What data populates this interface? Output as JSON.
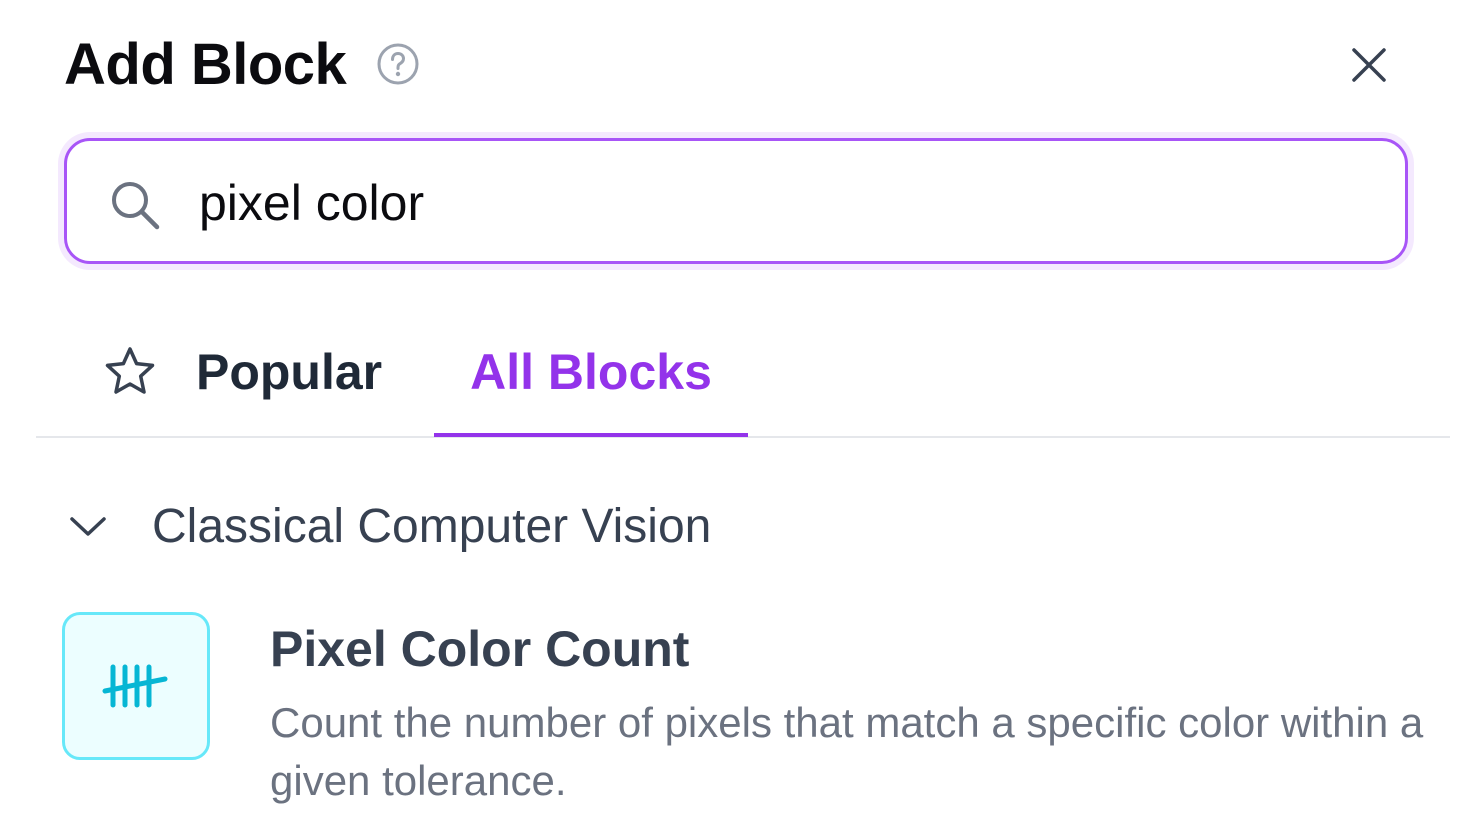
{
  "header": {
    "title": "Add Block",
    "help_icon": "question-circle-icon",
    "close_icon": "close-icon"
  },
  "search": {
    "icon": "search-icon",
    "value": "pixel color",
    "placeholder": ""
  },
  "tabs": [
    {
      "label": "Popular",
      "icon": "star-icon",
      "active": false
    },
    {
      "label": "All Blocks",
      "icon": "",
      "active": true
    }
  ],
  "section": {
    "icon": "chevron-down-icon",
    "title": "Classical Computer Vision",
    "expanded": true
  },
  "blocks": [
    {
      "icon": "tally-marks-icon",
      "title": "Pixel Color Count",
      "description": "Count the number of pixels that match a specific color within a given tolerance."
    }
  ],
  "colors": {
    "accent": "#9333ea",
    "search_border": "#a855f7",
    "title_text": "#0b0b0f",
    "block_icon_bg": "#ecfeff",
    "block_icon_border": "#67e8f9",
    "block_icon_fg": "#06b6d4"
  }
}
